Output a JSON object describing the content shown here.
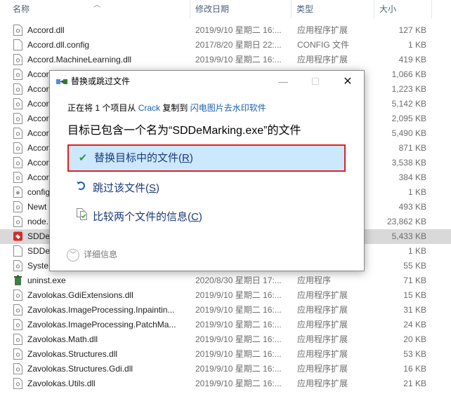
{
  "columns": {
    "name": "名称",
    "date": "修改日期",
    "type": "类型",
    "size": "大小"
  },
  "files": [
    {
      "name": "Accord.dll",
      "date": "2019/9/10 星期二 16:...",
      "type": "应用程序扩展",
      "size": "127 KB"
    },
    {
      "name": "Accord.dll.config",
      "date": "2017/8/20 星期日 22:...",
      "type": "CONFIG 文件",
      "size": "1 KB"
    },
    {
      "name": "Accord.MachineLearning.dll",
      "date": "2019/9/10 星期二 16:...",
      "type": "应用程序扩展",
      "size": "419 KB"
    },
    {
      "name": "Accord",
      "date": "",
      "type": "",
      "size": "1,066 KB"
    },
    {
      "name": "Accord",
      "date": "",
      "type": "",
      "size": "1,223 KB"
    },
    {
      "name": "Accord",
      "date": "",
      "type": "",
      "size": "5,142 KB"
    },
    {
      "name": "Accord",
      "date": "",
      "type": "",
      "size": "2,095 KB"
    },
    {
      "name": "Accord",
      "date": "",
      "type": "",
      "size": "5,490 KB"
    },
    {
      "name": "Accord",
      "date": "",
      "type": "",
      "size": "871 KB"
    },
    {
      "name": "Accord",
      "date": "",
      "type": "",
      "size": "3,538 KB"
    },
    {
      "name": "Accord",
      "date": "",
      "type": "",
      "size": "384 KB"
    },
    {
      "name": "config",
      "date": "",
      "type": "",
      "size": "1 KB"
    },
    {
      "name": "Newt",
      "date": "",
      "type": "",
      "size": "493 KB"
    },
    {
      "name": "node.",
      "date": "",
      "type": "",
      "size": "23,862 KB"
    },
    {
      "name": "SDDe",
      "date": "",
      "type": "",
      "size": "5,433 KB"
    },
    {
      "name": "SDDe",
      "date": "",
      "type": "",
      "size": "1 KB"
    },
    {
      "name": "Syste",
      "date": "",
      "type": "",
      "size": "55 KB"
    },
    {
      "name": "uninst.exe",
      "date": "2020/8/30 星期日 17:...",
      "type": "应用程序",
      "size": "71 KB"
    },
    {
      "name": "Zavolokas.GdiExtensions.dll",
      "date": "2019/9/10 星期二 16:...",
      "type": "应用程序扩展",
      "size": "15 KB"
    },
    {
      "name": "Zavolokas.ImageProcessing.Inpaintin...",
      "date": "2019/9/10 星期二 16:...",
      "type": "应用程序扩展",
      "size": "31 KB"
    },
    {
      "name": "Zavolokas.ImageProcessing.PatchMa...",
      "date": "2019/9/10 星期二 16:...",
      "type": "应用程序扩展",
      "size": "24 KB"
    },
    {
      "name": "Zavolokas.Math.dll",
      "date": "2019/9/10 星期二 16:...",
      "type": "应用程序扩展",
      "size": "20 KB"
    },
    {
      "name": "Zavolokas.Structures.dll",
      "date": "2019/9/10 星期二 16:...",
      "type": "应用程序扩展",
      "size": "53 KB"
    },
    {
      "name": "Zavolokas.Structures.Gdi.dll",
      "date": "2019/9/10 星期二 16:...",
      "type": "应用程序扩展",
      "size": "16 KB"
    },
    {
      "name": "Zavolokas.Utils.dll",
      "date": "2019/9/10 星期二 16:...",
      "type": "应用程序扩展",
      "size": "21 KB"
    }
  ],
  "dialog": {
    "title": "替换或跳过文件",
    "progress_prefix": "正在将 1 个项目从 ",
    "source": "Crack",
    "copy_to": " 复制到 ",
    "destination": "闪电图片去水印软件",
    "message": "目标已包含一个名为“SDDeMarking.exe”的文件",
    "option_replace": "替换目标中的文件(",
    "option_replace_key": "R",
    "option_skip": "跳过该文件(",
    "option_skip_key": "S",
    "option_compare": "比较两个文件的信息(",
    "option_compare_key": "C",
    "more_details": "详细信息",
    "accent_color": "#e02020"
  }
}
